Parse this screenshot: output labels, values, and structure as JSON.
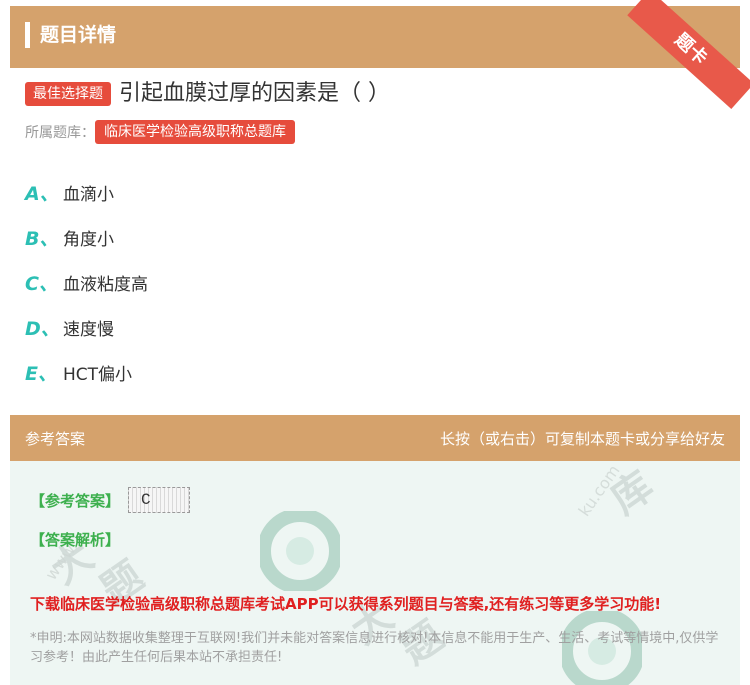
{
  "header": {
    "title": "题目详情",
    "ribbon": "题卡"
  },
  "question": {
    "type_tag": "最佳选择题",
    "text": "引起血膜过厚的因素是（ ）"
  },
  "bank": {
    "label": "所属题库：",
    "name": "临床医学检验高级职称总题库"
  },
  "options": [
    {
      "letter": "A、",
      "text": "血滴小"
    },
    {
      "letter": "B、",
      "text": "角度小"
    },
    {
      "letter": "C、",
      "text": "血液粘度高"
    },
    {
      "letter": "D、",
      "text": "速度慢"
    },
    {
      "letter": "E、",
      "text": "HCT偏小"
    }
  ],
  "answer_section": {
    "title": "参考答案",
    "hint": "长按（或右击）可复制本题卡或分享给好友",
    "answer_label": "【参考答案】",
    "answer_value": "C",
    "analysis_label": "【答案解析】",
    "promo": "下载临床医学检验高级职称总题库考试APP可以获得系列题目与答案,还有练习等更多学习功能!",
    "disclaimer": "*申明:本网站数据收集整理于互联网!我们并未能对答案信息进行核对!本信息不能用于生产、生活、考试等情境中,仅供学习参考！由此产生任何后果本站不承担责任!"
  },
  "colors": {
    "header_bg": "#d5a26c",
    "tag_red": "#e64c3c",
    "option_letter": "#2cbfb4",
    "answer_green": "#3db04e",
    "promo_red": "#e02020"
  }
}
